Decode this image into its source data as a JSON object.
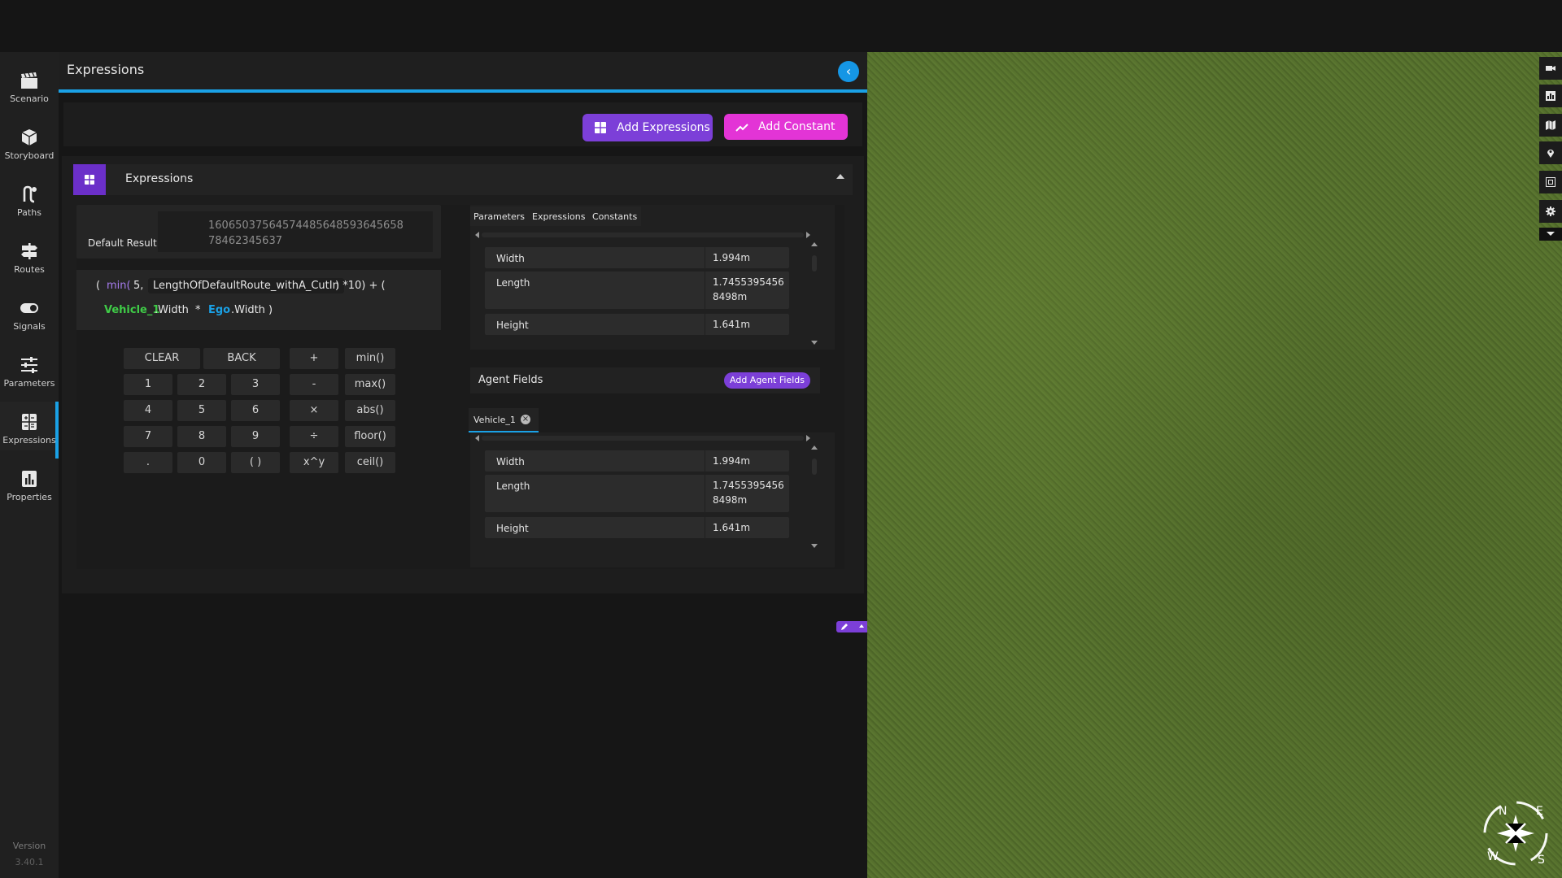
{
  "nav": {
    "items": [
      {
        "label": "Scenario",
        "icon": "clapperboard-icon"
      },
      {
        "label": "Storyboard",
        "icon": "box-icon"
      },
      {
        "label": "Paths",
        "icon": "paths-icon"
      },
      {
        "label": "Routes",
        "icon": "signpost-icon"
      },
      {
        "label": "Signals",
        "icon": "toggle-icon"
      },
      {
        "label": "Parameters",
        "icon": "sliders-icon"
      },
      {
        "label": "Expressions",
        "icon": "grid-icon"
      },
      {
        "label": "Properties",
        "icon": "bar-chart-icon"
      }
    ],
    "active": "Expressions",
    "version_label": "Version",
    "version_value": "3.40.1"
  },
  "panel": {
    "title": "Expressions",
    "add_expressions_label": "Add Expressions",
    "add_constant_label": "Add Constant",
    "section_title": "Expressions"
  },
  "calculator": {
    "result_label": "Default Result",
    "result_value": "1606503756457448564859364565878462345637",
    "expression": {
      "open_paren": "(",
      "fn_min": "min(",
      "arg_5": "5,",
      "route_var": "LengthOfDefaultRoute_withA_CutIn",
      "after_route": ") *10) + (",
      "vehicle_obj": "Vehicle_1",
      "vehicle_field": ".Width",
      "times": "*",
      "ego_obj": "Ego",
      "ego_field": ".Width",
      "close_paren": ")"
    },
    "keys": [
      [
        "CLEAR",
        "BACK",
        "+",
        "min()"
      ],
      [
        "1",
        "2",
        "3",
        "-",
        "max()"
      ],
      [
        "4",
        "5",
        "6",
        "×",
        "abs()"
      ],
      [
        "7",
        "8",
        "9",
        "÷",
        "floor()"
      ],
      [
        ".",
        "0",
        "( )",
        "x^y",
        "ceil()"
      ]
    ]
  },
  "catalog": {
    "tabs": [
      "Parameters",
      "Expressions",
      "Constants"
    ],
    "rows": [
      {
        "name": "Width",
        "value": "1.994m"
      },
      {
        "name": "Length",
        "value": "1.74553954568498m"
      },
      {
        "name": "Height",
        "value": "1.641m"
      }
    ]
  },
  "agent_fields": {
    "title": "Agent Fields",
    "add_label": "Add Agent Fields",
    "tab_label": "Vehicle_1",
    "rows": [
      {
        "name": "Width",
        "value": "1.994m"
      },
      {
        "name": "Length",
        "value": "1.74553954568498m"
      },
      {
        "name": "Height",
        "value": "1.641m"
      }
    ]
  },
  "compass": {
    "n": "N",
    "e": "E",
    "s": "S",
    "w": "W"
  },
  "colors": {
    "accent_blue": "#1aa1e6",
    "purple": "#7c3fd8",
    "magenta": "#e334d6",
    "green_var": "#3fcc47",
    "grass": "#546d2c"
  }
}
